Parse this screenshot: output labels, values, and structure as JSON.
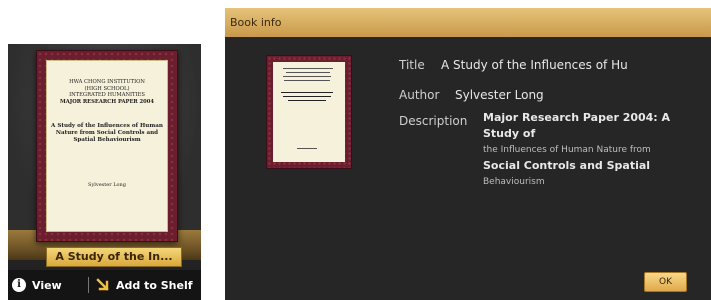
{
  "shelf": {
    "book_cover": {
      "line1": "HWA CHONG INSTITUTION",
      "line2": "(HIGH SCHOOL)",
      "line3": "INTEGRATED HUMANITIES",
      "line4": "MAJOR RESEARCH PAPER 2004",
      "title": "A Study of the Influences of Human Nature from Social Controls and Spatial Behaviourism",
      "author": "Sylvester Long"
    },
    "title_strip": "A Study of the In...",
    "actions": {
      "view_label": "View",
      "view_icon": "info-icon",
      "add_label": "Add to Shelf",
      "add_icon": "arrow-down-right-icon"
    }
  },
  "dialog": {
    "title": "Book info",
    "fields": {
      "title_label": "Title",
      "title_value": "A Study of the Influences of Hu",
      "author_label": "Author",
      "author_value": "Sylvester Long",
      "description_label": "Description",
      "description_line1": "Major Research Paper 2004: A Study of",
      "description_line2": "the Influences of Human Nature from",
      "description_line3": "Social Controls and Spatial",
      "description_line4": "Behaviourism"
    },
    "ok_label": "OK"
  },
  "colors": {
    "gold_light": "#f5d67a",
    "gold_dark": "#c9994a",
    "panel_dark": "#262626",
    "cover_maroon": "#6b1e2e"
  }
}
